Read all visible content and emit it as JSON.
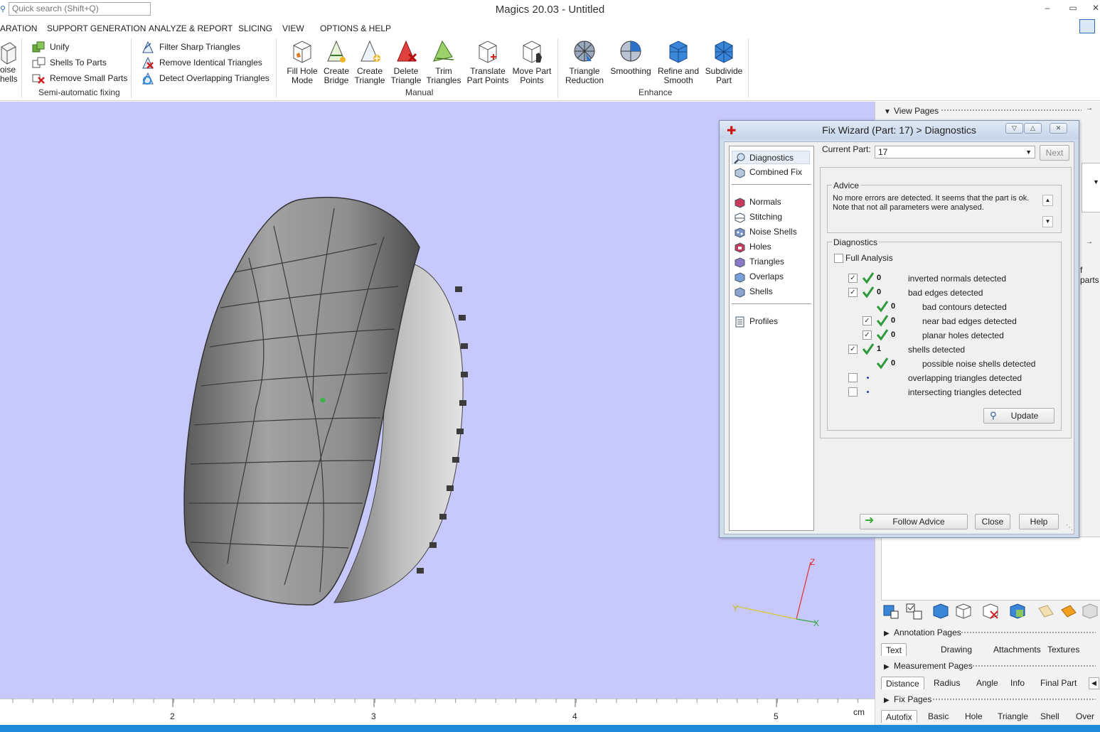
{
  "app": {
    "title": "Magics 20.03 - Untitled",
    "search_placeholder": "Quick search (Shift+Q)"
  },
  "menu": [
    "ARATION",
    "SUPPORT GENERATION",
    "ANALYZE & REPORT",
    "SLICING",
    "VIEW",
    "OPTIONS & HELP"
  ],
  "ribbon": {
    "noise_shells": [
      "oise",
      "hells"
    ],
    "semi_auto": {
      "items": [
        "Unify",
        "Shells To Parts",
        "Remove Small Parts"
      ],
      "label": "Semi-automatic fixing"
    },
    "triangles": [
      "Filter Sharp Triangles",
      "Remove Identical Triangles",
      "Detect Overlapping Triangles"
    ],
    "manual": {
      "items": [
        [
          "Fill Hole",
          "Mode"
        ],
        [
          "Create",
          "Bridge"
        ],
        [
          "Create",
          "Triangle"
        ],
        [
          "Delete",
          "Triangle"
        ],
        [
          "Trim",
          "Triangles"
        ],
        [
          "Translate",
          "Part Points"
        ],
        [
          "Move Part",
          "Points"
        ]
      ],
      "label": "Manual"
    },
    "enhance": {
      "items": [
        [
          "Triangle",
          "Reduction"
        ],
        [
          "Smoothing",
          ""
        ],
        [
          "Refine and",
          "Smooth"
        ],
        [
          "Subdivide",
          "Part"
        ]
      ],
      "label": "Enhance"
    }
  },
  "axes": {
    "x": "X",
    "y": "Y",
    "z": "Z"
  },
  "ruler": {
    "ticks": [
      "2",
      "3",
      "4",
      "5"
    ],
    "unit": "cm"
  },
  "dialog": {
    "title": "Fix Wizard (Part: 17) > Diagnostics",
    "nav": {
      "top": [
        "Diagnostics",
        "Combined Fix"
      ],
      "mid": [
        "Normals",
        "Stitching",
        "Noise Shells",
        "Holes",
        "Triangles",
        "Overlaps",
        "Shells"
      ],
      "bottom": [
        "Profiles"
      ]
    },
    "current_part_label": "Current Part:",
    "current_part_value": "17",
    "next_label": "Next",
    "advice_title": "Advice",
    "advice_lines": [
      "No more errors are detected. It seems that the part is ok.",
      "Note that not all parameters were analysed."
    ],
    "diagnostics_title": "Diagnostics",
    "full_analysis_label": "Full Analysis",
    "rows": [
      {
        "checkbox": "checked",
        "status": "ok",
        "count": "0",
        "label": "inverted normals detected",
        "indent": false
      },
      {
        "checkbox": "checked",
        "status": "ok",
        "count": "0",
        "label": "bad edges detected",
        "indent": false
      },
      {
        "checkbox": "none",
        "status": "ok",
        "count": "0",
        "label": "bad contours detected",
        "indent": true
      },
      {
        "checkbox": "checked",
        "status": "ok",
        "count": "0",
        "label": "near bad edges detected",
        "indent": true
      },
      {
        "checkbox": "checked",
        "status": "ok",
        "count": "0",
        "label": "planar holes detected",
        "indent": true
      },
      {
        "checkbox": "checked",
        "status": "ok",
        "count": "1",
        "label": "shells detected",
        "indent": false
      },
      {
        "checkbox": "none",
        "status": "ok",
        "count": "0",
        "label": "possible noise shells detected",
        "indent": true
      },
      {
        "checkbox": "unchecked",
        "status": "pending",
        "count": "",
        "label": "overlapping triangles detected",
        "indent": false
      },
      {
        "checkbox": "unchecked",
        "status": "pending",
        "count": "",
        "label": "intersecting triangles detected",
        "indent": false
      }
    ],
    "update_label": "Update",
    "follow_advice_label": "Follow Advice",
    "close_label": "Close",
    "help_label": "Help"
  },
  "right_panel": {
    "view_pages": "View Pages",
    "parts_fragment": "f parts",
    "annotation_pages": "Annotation Pages",
    "annotation_tabs": [
      "Text",
      "Drawing",
      "Attachments",
      "Textures"
    ],
    "measurement_pages": "Measurement Pages",
    "measurement_tabs": [
      "Distance",
      "Radius",
      "Angle",
      "Info",
      "Final Part"
    ],
    "fix_pages": "Fix Pages",
    "fix_tabs": [
      "Autofix",
      "Basic",
      "Hole",
      "Triangle",
      "Shell",
      "Over"
    ]
  }
}
